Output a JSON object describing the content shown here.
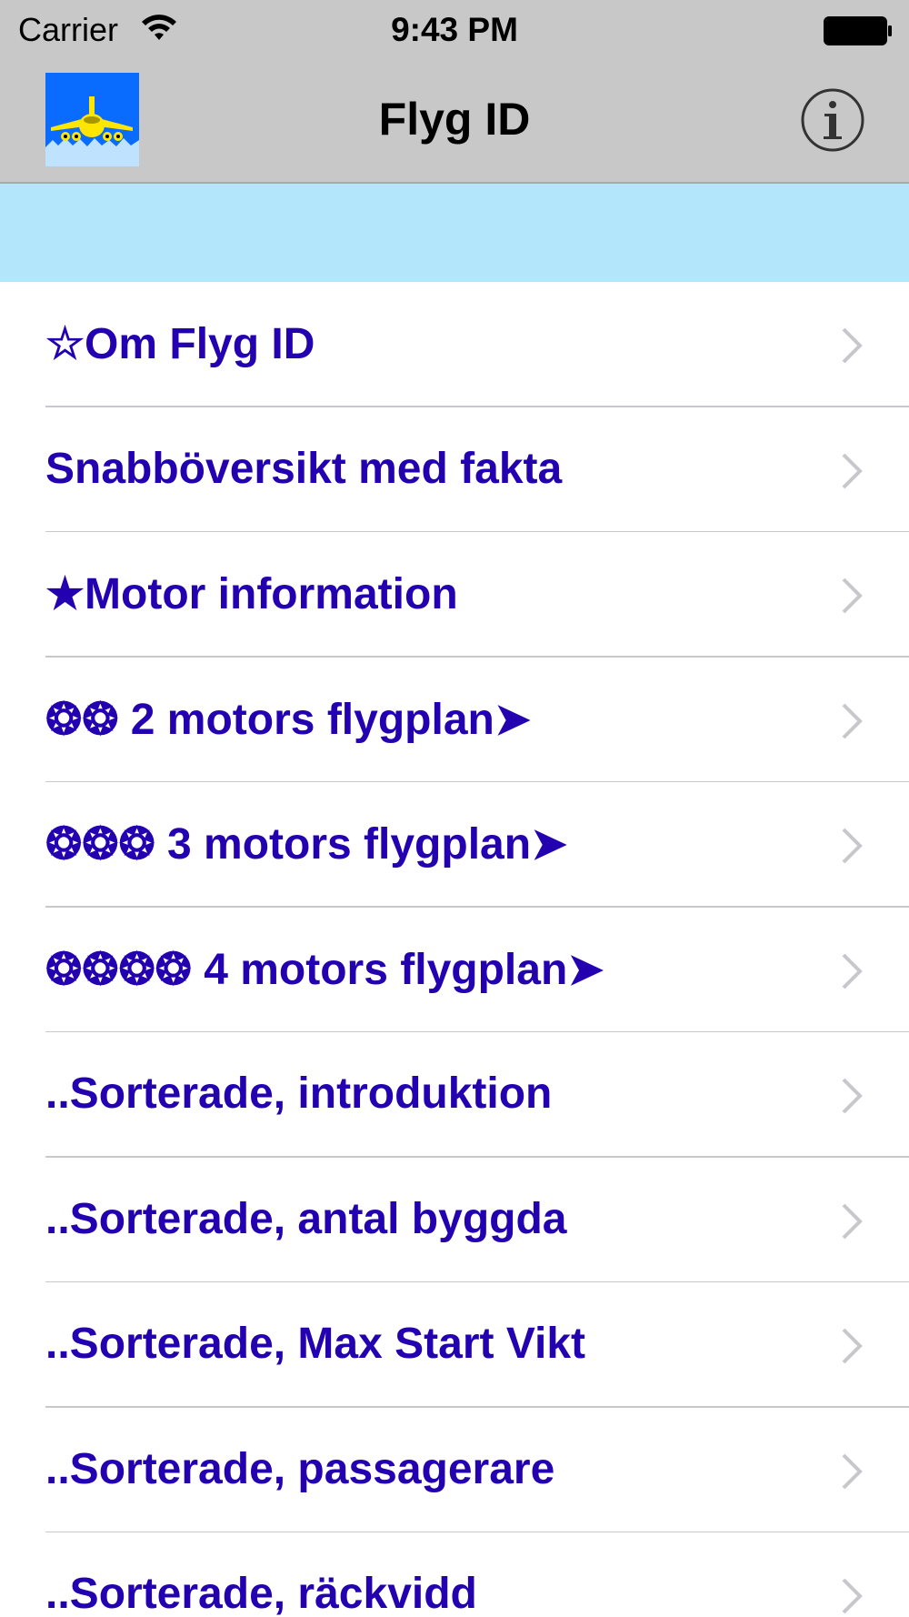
{
  "status_bar": {
    "carrier": "Carrier",
    "time": "9:43 PM",
    "wifi_icon": "wifi-icon",
    "battery_icon": "battery-icon"
  },
  "nav_bar": {
    "title": "Flyg ID",
    "logo_icon": "airplane-logo-icon",
    "info_icon": "info-icon"
  },
  "banner": {
    "color": "#b3e6fb"
  },
  "colors": {
    "label": "#2300b0",
    "nav_background": "#c8c8c8",
    "chevron": "#c7c7cc"
  },
  "menu": {
    "items": [
      {
        "label": "☆Om Flyg ID"
      },
      {
        "label": "Snabböversikt med fakta"
      },
      {
        "label": "★Motor information"
      },
      {
        "label": "❂❂ 2 motors flygplan➤"
      },
      {
        "label": "❂❂❂ 3 motors flygplan➤"
      },
      {
        "label": "❂❂❂❂ 4 motors flygplan➤"
      },
      {
        "label": "..Sorterade, introduktion"
      },
      {
        "label": "..Sorterade, antal byggda"
      },
      {
        "label": "..Sorterade, Max Start Vikt"
      },
      {
        "label": "..Sorterade, passagerare"
      },
      {
        "label": "..Sorterade, räckvidd"
      }
    ]
  }
}
